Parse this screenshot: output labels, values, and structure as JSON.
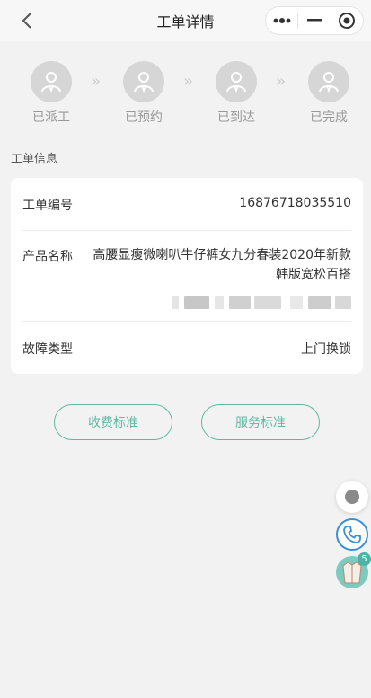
{
  "navbar": {
    "title": "工单详情"
  },
  "steps": [
    {
      "label": "已派工"
    },
    {
      "label": "已预约"
    },
    {
      "label": "已到达"
    },
    {
      "label": "已完成"
    }
  ],
  "step_arrow": "»",
  "section": {
    "title": "工单信息"
  },
  "order": {
    "number_label": "工单编号",
    "number_value": "16876718035510",
    "product_label": "产品名称",
    "product_value": "高腰显瘦微喇叭牛仔裤女九分春装2020年新款韩版宽松百搭",
    "fault_label": "故障类型",
    "fault_value": "上门换锁"
  },
  "buttons": {
    "fee_standard": "收费标准",
    "service_standard": "服务标准"
  },
  "float": {
    "badge_count": "5"
  },
  "colors": {
    "accent": "#5fb9a2",
    "step_inactive": "#d6d6d6",
    "phone": "#3a8fd6"
  }
}
